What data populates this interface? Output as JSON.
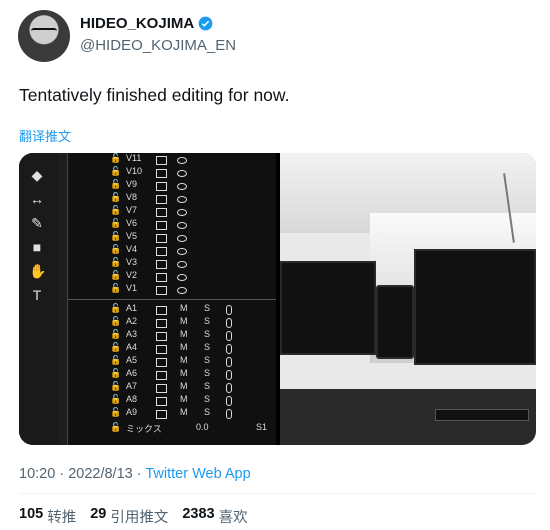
{
  "author": {
    "name": "HIDEO_KOJIMA",
    "handle": "@HIDEO_KOJIMA_EN",
    "verified_icon": "verified-badge-icon"
  },
  "tweet": {
    "text": "Tentatively finished editing for now.",
    "translate_label": "翻译推文"
  },
  "editor": {
    "video_tracks": [
      "V11",
      "V10",
      "V9",
      "V8",
      "V7",
      "V6",
      "V5",
      "V4",
      "V3",
      "V2",
      "V1"
    ],
    "audio_tracks": [
      "A1",
      "A2",
      "A3",
      "A4",
      "A5",
      "A6",
      "A7",
      "A8",
      "A9"
    ],
    "audio_m": "M",
    "audio_s": "S",
    "mix_label": "ミックス",
    "mix_value": "0.0",
    "mix_s1": "S1"
  },
  "meta": {
    "time": "10:20",
    "dot1": "·",
    "date": "2022/8/13",
    "dot2": "·",
    "app": "Twitter Web App"
  },
  "stats": {
    "retweets_count": "105",
    "retweets_label": "转推",
    "quotes_count": "29",
    "quotes_label": "引用推文",
    "likes_count": "2383",
    "likes_label": "喜欢"
  }
}
